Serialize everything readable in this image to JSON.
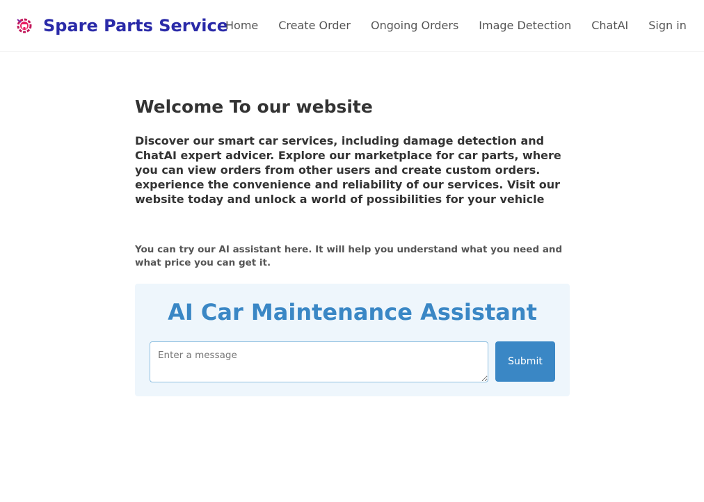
{
  "navbar": {
    "brand_name": "Spare Parts Service",
    "logo_icon": "car-gear-logo-icon",
    "brand_color": "#2a2aa8",
    "links": [
      {
        "label": "Home"
      },
      {
        "label": "Create Order"
      },
      {
        "label": "Ongoing Orders"
      },
      {
        "label": "Image Detection"
      },
      {
        "label": "ChatAI"
      },
      {
        "label": "Sign in"
      }
    ]
  },
  "main": {
    "title": "Welcome To our website",
    "intro": "Discover our smart car services, including damage detection and ChatAI expert advicer. Explore our marketplace for car parts, where you can view orders from other users and create custom orders. experience the convenience and reliability of our services. Visit our website today and unlock a world of possibilities for your vehicle",
    "assistant_note": "You can try our AI assistant here. It will help you understand what you need and what price you can get it."
  },
  "assistant": {
    "title": "AI Car Maintenance Assistant",
    "input_placeholder": "Enter a message",
    "input_value": "",
    "submit_label": "Submit",
    "accent_color": "#3a87c5",
    "panel_background": "#eef6fc"
  }
}
